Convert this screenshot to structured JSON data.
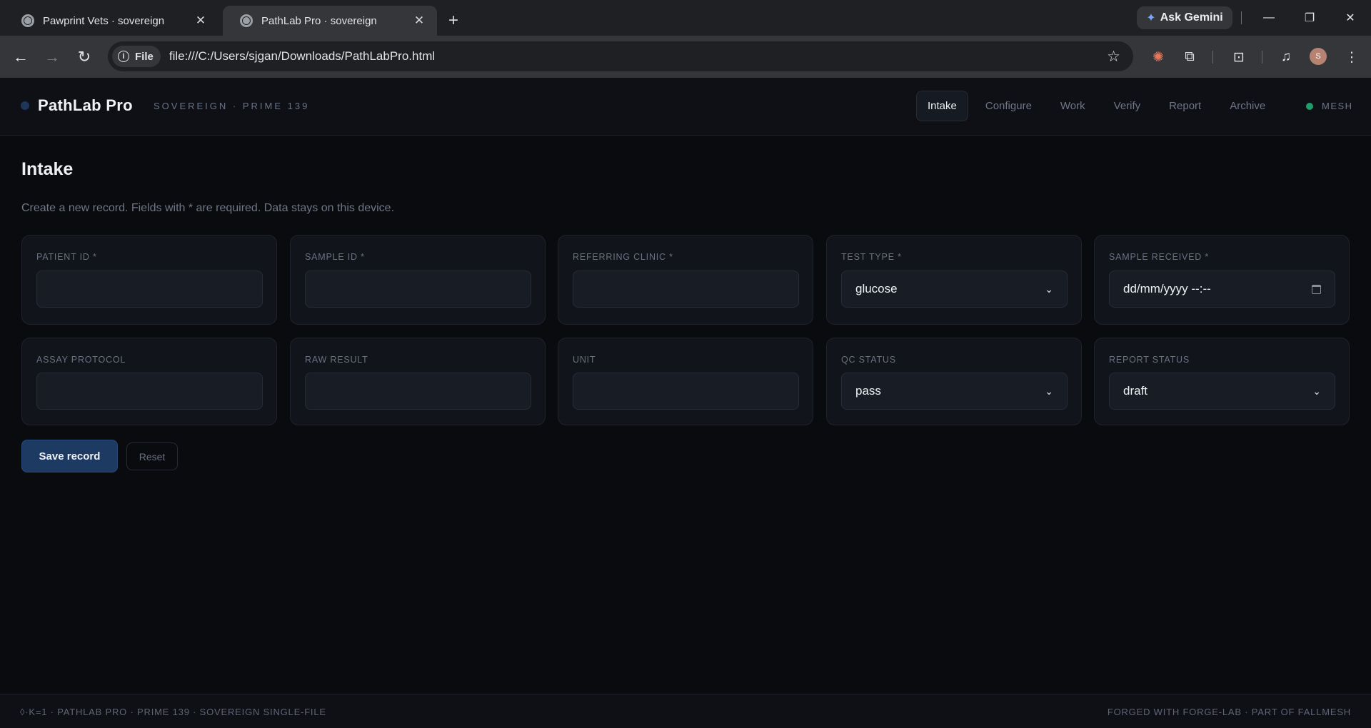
{
  "browser": {
    "tabs": [
      {
        "title": "Pawprint Vets · sovereign",
        "active": false
      },
      {
        "title": "PathLab Pro · sovereign",
        "active": true
      }
    ],
    "ask_gemini": "Ask Gemini",
    "chip_label": "File",
    "url": "file:///C:/Users/sjgan/Downloads/PathLabPro.html",
    "profile_initial": "S"
  },
  "app": {
    "brand": "PathLab Pro",
    "subtitle": "Sovereign · Prime 139",
    "nav": [
      "Intake",
      "Configure",
      "Work",
      "Verify",
      "Report",
      "Archive"
    ],
    "active_nav": "Intake",
    "mesh_label": "MESH",
    "mesh_color": "#1f9d6b"
  },
  "page": {
    "title": "Intake",
    "description": "Create a new record. Fields with * are required. Data stays on this device."
  },
  "fields": [
    {
      "label": "Patient ID *",
      "value": "",
      "type": "text"
    },
    {
      "label": "Sample ID *",
      "value": "",
      "type": "text"
    },
    {
      "label": "Referring clinic *",
      "value": "",
      "type": "text"
    },
    {
      "label": "Test type *",
      "value": "glucose",
      "type": "select"
    },
    {
      "label": "Sample received *",
      "value": "dd/mm/yyyy --:--",
      "type": "datetime"
    },
    {
      "label": "Assay protocol",
      "value": "",
      "type": "text"
    },
    {
      "label": "Raw result",
      "value": "",
      "type": "text"
    },
    {
      "label": "Unit",
      "value": "",
      "type": "text"
    },
    {
      "label": "QC status",
      "value": "pass",
      "type": "select"
    },
    {
      "label": "Report status",
      "value": "draft",
      "type": "select"
    }
  ],
  "actions": {
    "save": "Save record",
    "reset": "Reset"
  },
  "footer": {
    "left": "◊·K=1 · PathLab Pro · Prime 139 · Sovereign single-file",
    "right": "Forged with Forge-Lab · Part of FallMesh"
  },
  "colors": {
    "accent": "#1d3a63",
    "background": "#0a0b0e",
    "panel": "#11141b"
  }
}
